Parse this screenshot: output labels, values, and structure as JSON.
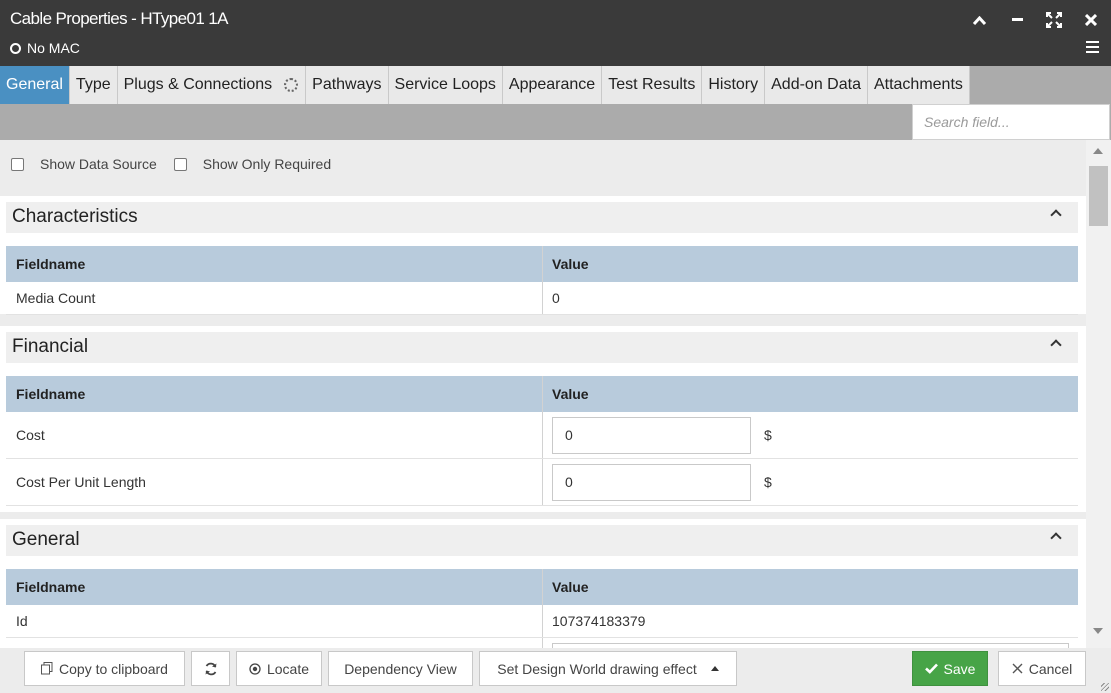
{
  "window": {
    "title": "Cable Properties - HType01 1A",
    "status": "No MAC",
    "icons": [
      "collapse-icon",
      "minimize-icon",
      "maximize-icon",
      "close-icon",
      "menu-icon"
    ]
  },
  "tabs": [
    {
      "label": "General",
      "active": true
    },
    {
      "label": "Type"
    },
    {
      "label": "Plugs & Connections",
      "loading": true
    },
    {
      "label": "Pathways"
    },
    {
      "label": "Service Loops"
    },
    {
      "label": "Appearance"
    },
    {
      "label": "Test Results"
    },
    {
      "label": "History"
    },
    {
      "label": "Add-on Data"
    },
    {
      "label": "Attachments"
    }
  ],
  "search": {
    "placeholder": "Search field..."
  },
  "options": {
    "show_data_source": "Show Data Source",
    "show_only_required": "Show Only Required"
  },
  "columns": {
    "fieldname": "Fieldname",
    "value": "Value"
  },
  "sections": {
    "characteristics": {
      "title": "Characteristics",
      "rows": [
        {
          "field": "Media Count",
          "value": "0"
        }
      ]
    },
    "financial": {
      "title": "Financial",
      "rows": [
        {
          "field": "Cost",
          "value": "0",
          "unit": "$"
        },
        {
          "field": "Cost Per Unit Length",
          "value": "0",
          "unit": "$"
        }
      ]
    },
    "general": {
      "title": "General",
      "rows": [
        {
          "field": "Id",
          "value": "107374183379"
        }
      ]
    }
  },
  "footer": {
    "copy": "Copy to clipboard",
    "locate": "Locate",
    "dependency": "Dependency View",
    "drawing_effect": "Set Design World drawing effect",
    "save": "Save",
    "cancel": "Cancel"
  },
  "colors": {
    "active_tab": "#4a90c2",
    "save": "#47a447",
    "grid_header": "#b8cbdc",
    "titlebar": "#3a3a3a"
  }
}
